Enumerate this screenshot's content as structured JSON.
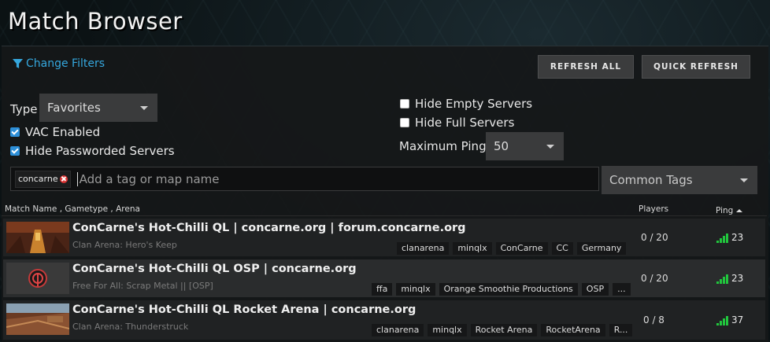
{
  "title": "Match Browser",
  "filters_link": "Change Filters",
  "buttons": {
    "refresh_all": "REFRESH ALL",
    "quick_refresh": "QUICK REFRESH"
  },
  "filters": {
    "type_label": "Type",
    "type_value": "Favorites",
    "vac_enabled": {
      "label": "VAC Enabled",
      "checked": true
    },
    "hide_passworded": {
      "label": "Hide Passworded Servers",
      "checked": true
    },
    "hide_empty": {
      "label": "Hide Empty Servers",
      "checked": false
    },
    "hide_full": {
      "label": "Hide Full Servers",
      "checked": false
    },
    "max_ping_label": "Maximum Ping",
    "max_ping_value": "50"
  },
  "tag_search": {
    "chip": "concarne",
    "placeholder": "Add a tag or map name"
  },
  "common_tags": "Common Tags",
  "columns": {
    "match": "Match Name ,  Gametype ,  Arena",
    "players": "Players",
    "ping": "Ping"
  },
  "servers": [
    {
      "name": "ConCarne's Hot-Chilli QL | concarne.org | forum.concarne.org",
      "subtitle": "Clan Arena: Hero's Keep",
      "tags": [
        "clanarena",
        "minqlx",
        "ConCarne",
        "CC",
        "Germany"
      ],
      "players": "0 / 20",
      "ping": "23",
      "thumb": "map-hero-keep"
    },
    {
      "name": "ConCarne's Hot-Chilli QL OSP | concarne.org",
      "subtitle": "Free For All: Scrap Metal || [OSP]",
      "tags": [
        "ffa",
        "minqlx",
        "Orange Smoothie Productions",
        "OSP",
        "..."
      ],
      "players": "0 / 20",
      "ping": "23",
      "thumb": "quake-logo"
    },
    {
      "name": "ConCarne's Hot-Chilli QL Rocket Arena | concarne.org",
      "subtitle": "Clan Arena: Thunderstruck",
      "tags": [
        "clanarena",
        "minqlx",
        "Rocket Arena",
        "RocketArena",
        "R..."
      ],
      "players": "0 / 8",
      "ping": "37",
      "thumb": "map-thunderstruck"
    }
  ],
  "colors": {
    "accent": "#35a7dd",
    "checkbox": "#2d8fd8",
    "ping_bars": "#21c63d"
  }
}
